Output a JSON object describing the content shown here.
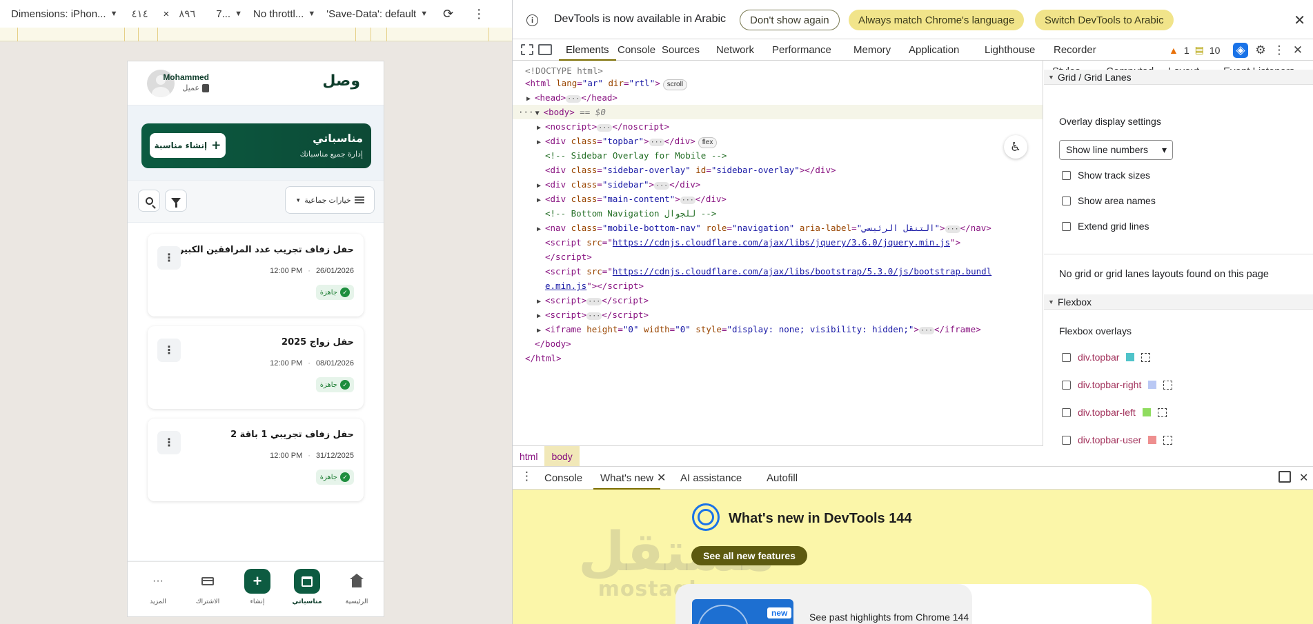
{
  "emulation": {
    "device": "Dimensions: iPhon...",
    "width": "٤١٤",
    "times": "×",
    "height": "٨٩٦",
    "zoom": "7...",
    "throttle": "No throttl...",
    "save_data": "'Save-Data': default",
    "more": "⋮"
  },
  "app": {
    "logo": "وصل",
    "user_name": "Mohammed",
    "user_role": "عميل",
    "hero_title": "مناسباتي",
    "hero_subtitle": "إدارة جميع مناسباتك",
    "create_label": "إنشاء مناسبة",
    "bulk_label": "خيارات جماعية",
    "events": [
      {
        "title": "حفل زفاف تجريب عدد المرافقين الكبير",
        "date": "26/01/2026",
        "time": "12:00 PM",
        "status": "جاهزة"
      },
      {
        "title": "حفل زواج 2025",
        "date": "08/01/2026",
        "time": "12:00 PM",
        "status": "جاهزة"
      },
      {
        "title": "حفل زفاف تجريبي 1 باقة 2",
        "date": "31/12/2025",
        "time": "12:00 PM",
        "status": "جاهزة"
      }
    ],
    "nav": {
      "home": "الرئيسية",
      "my_events": "مناسباتي",
      "create": "إنشاء",
      "subscription": "الاشتراك",
      "more": "المزيد"
    }
  },
  "devtools": {
    "infobar": {
      "message": "DevTools is now available in Arabic",
      "dont_show": "Don't show again",
      "match": "Always match Chrome's language",
      "switch": "Switch DevTools to Arabic"
    },
    "tabs": [
      "Elements",
      "Console",
      "Sources",
      "Network",
      "Performance",
      "Memory",
      "Application",
      "Lighthouse",
      "Recorder"
    ],
    "issues_warn": "1",
    "issues_msg": "10",
    "dom": {
      "doctype": "<!DOCTYPE html>",
      "html_lang": "\"ar\"",
      "html_dir": "\"rtl\"",
      "scroll_badge": "scroll",
      "flex_badge": "flex",
      "body_eq": "== $0",
      "comment_sidebar": "<!-- Sidebar Overlay for Mobile -->",
      "sidebar_overlay_class": "\"sidebar-overlay\"",
      "sidebar_overlay_id": "\"sidebar-overlay\"",
      "topbar_class": "\"topbar\"",
      "sidebar_class": "\"sidebar\"",
      "main_class": "\"main-content\"",
      "comment_nav": "<!-- Bottom Navigation للجوال -->",
      "nav_class": "\"mobile-bottom-nav\"",
      "nav_role": "\"navigation\"",
      "nav_aria": "\"التنقل الرئيسي\"",
      "jquery_src": "https://cdnjs.cloudflare.com/ajax/libs/jquery/3.6.0/jquery.min.js",
      "bootstrap_src_1": "https://cdnjs.cloudflare.com/ajax/libs/bootstrap/5.3.0/js/bootstrap.bundl",
      "bootstrap_src_2": "e.min.js",
      "iframe_height": "\"0\"",
      "iframe_width": "\"0\"",
      "iframe_style": "\"display: none; visibility: hidden;\""
    },
    "breadcrumbs": [
      "html",
      "body"
    ],
    "side_tabs": [
      "Styles",
      "Computed",
      "Layout",
      "Event Listeners"
    ],
    "layout": {
      "grid_section": "Grid / Grid Lanes",
      "overlay_settings": "Overlay display settings",
      "line_numbers": "Show line numbers",
      "show_track_sizes": "Show track sizes",
      "show_area_names": "Show area names",
      "extend_grid_lines": "Extend grid lines",
      "no_grid": "No grid or grid lanes layouts found on this page",
      "flexbox_section": "Flexbox",
      "flexbox_overlays": "Flexbox overlays",
      "flex_items": [
        {
          "name": "div.topbar",
          "color": "#4fc3c9"
        },
        {
          "name": "div.topbar-right",
          "color": "#b9c8f4"
        },
        {
          "name": "div.topbar-left",
          "color": "#8fdc5f"
        },
        {
          "name": "div.topbar-user",
          "color": "#ee8f8f"
        }
      ]
    },
    "drawer_tabs": [
      "Console",
      "What's new",
      "AI assistance",
      "Autofill"
    ],
    "whats_new": {
      "title": "What's new in DevTools 144",
      "button": "See all new features",
      "badge": "new",
      "card_text": "See past highlights from Chrome 144"
    },
    "watermark": {
      "line1": "مستقل",
      "line2": "mostaql.com"
    }
  }
}
